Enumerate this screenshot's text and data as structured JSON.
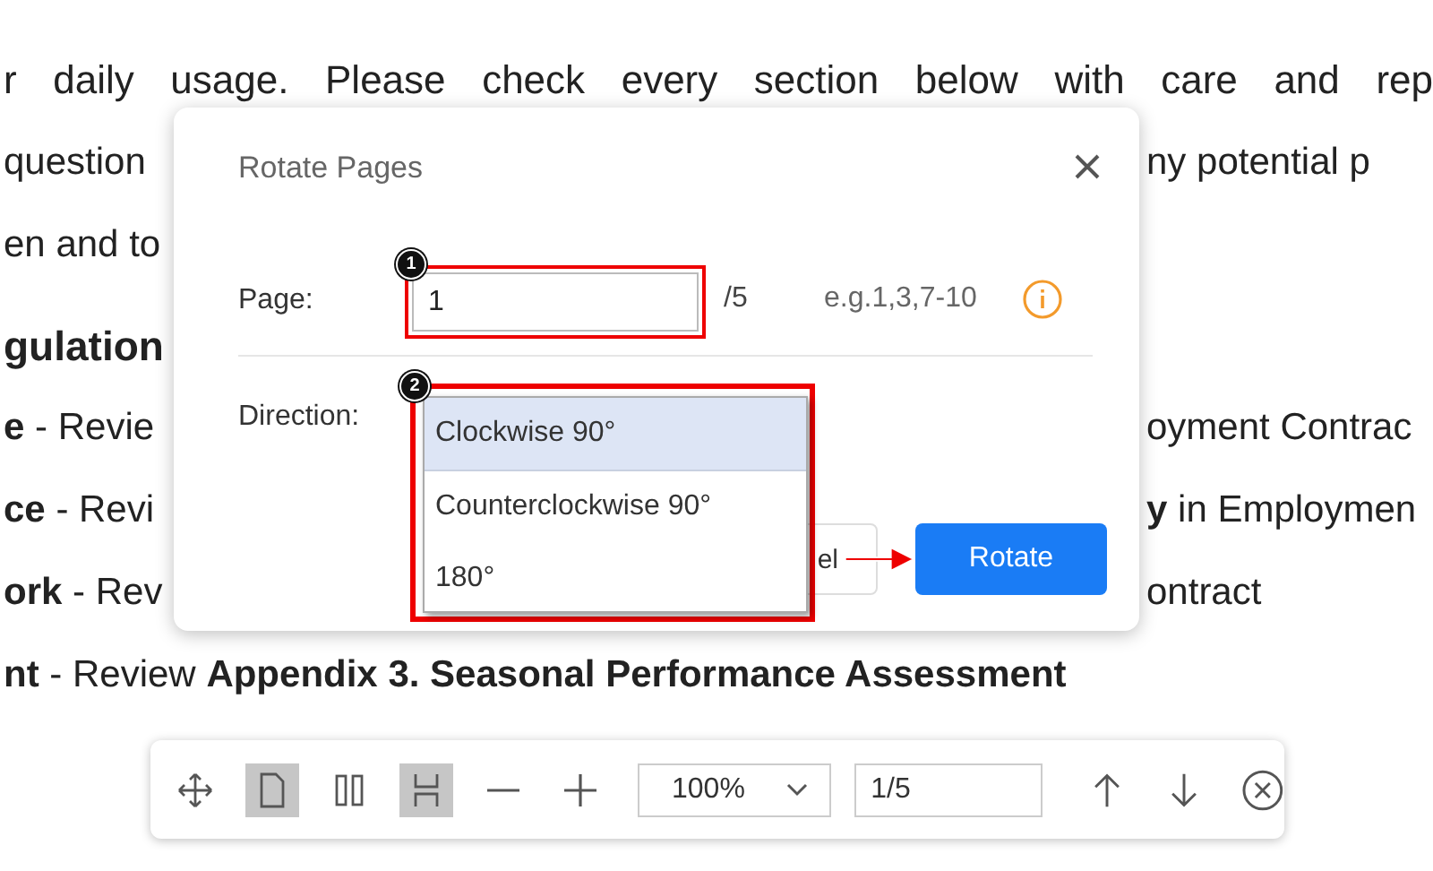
{
  "document": {
    "lines": [
      {
        "kind": "body",
        "left": "r daily usage. Please check every section below with care and rep"
      },
      {
        "kind": "body",
        "left": "question",
        "right": "ny potential p"
      },
      {
        "kind": "body",
        "left": "en and to"
      },
      {
        "kind": "heading",
        "left": "gulation"
      },
      {
        "kind": "body",
        "left": "**e** - Revie",
        "right": "oyment Contrac"
      },
      {
        "kind": "body",
        "left": "**ce** - Revi",
        "right": "**y** in Employmen"
      },
      {
        "kind": "body",
        "left": "**ork** - Rev",
        "right": "ontract"
      },
      {
        "kind": "body",
        "left": "**nt** - Review **Appendix 3. Seasonal Performance Assessment**"
      }
    ]
  },
  "dialog": {
    "title": "Rotate Pages",
    "page": {
      "label": "Page:",
      "value": "1",
      "total": "/5",
      "hint": "e.g.1,3,7-10",
      "badge": "1"
    },
    "direction": {
      "label": "Direction:",
      "badge": "2",
      "options": [
        {
          "label": "Clockwise 90°",
          "selected": true
        },
        {
          "label": "Counterclockwise 90°",
          "selected": false
        },
        {
          "label": "180°",
          "selected": false
        }
      ]
    },
    "buttons": [
      {
        "kind": "secondary",
        "label": "el"
      },
      {
        "kind": "primary",
        "label": "Rotate"
      }
    ]
  },
  "toolbar": {
    "tools": [
      {
        "kind": "move",
        "active": false
      },
      {
        "kind": "single-page",
        "active": true
      },
      {
        "kind": "two-page",
        "active": false
      },
      {
        "kind": "fit-height",
        "active": true
      },
      {
        "kind": "zoom-out",
        "active": false
      },
      {
        "kind": "zoom-in",
        "active": false
      }
    ],
    "zoom": "100%",
    "page": "1/5"
  }
}
